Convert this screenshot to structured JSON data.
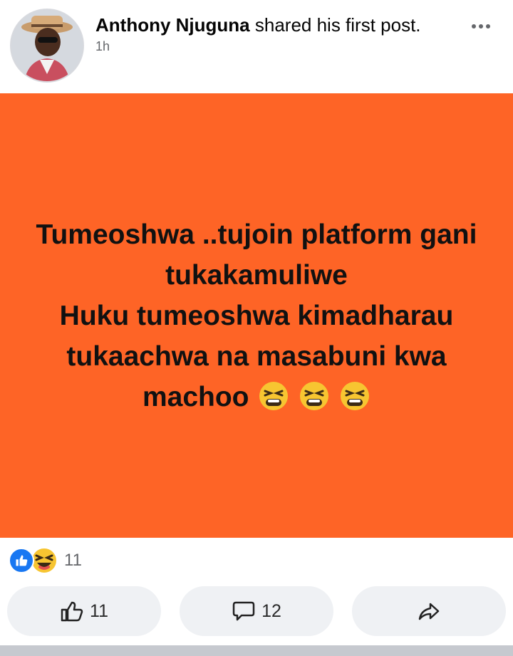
{
  "header": {
    "author_name": "Anthony Njuguna",
    "action_text": " shared his first post.",
    "time": "1h",
    "more_icon": "more-horizontal-icon"
  },
  "post": {
    "background_color": "#fe6426",
    "lines": [
      "Tumeoshwa ..tujoin platform gani",
      "tukakamuliwe",
      "Huku tumeoshwa kimadharau",
      "tukaachwa na masabuni kwa",
      "machoo"
    ],
    "trailing_emojis": [
      "tired-face-icon",
      "tired-face-icon",
      "tired-face-icon"
    ]
  },
  "reactions": {
    "icons": [
      "like-reaction-icon",
      "haha-reaction-icon"
    ],
    "count": "11"
  },
  "actions": {
    "like_count": "11",
    "comment_count": "12",
    "share_icon": "share-icon"
  }
}
